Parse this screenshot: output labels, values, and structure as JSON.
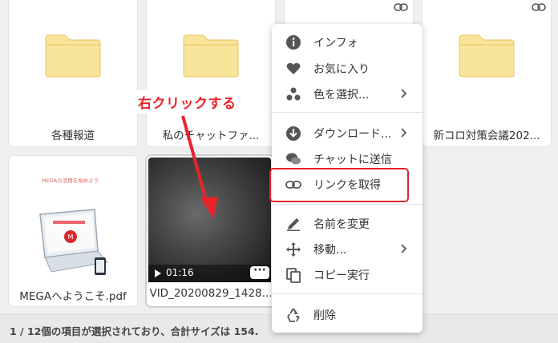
{
  "cards": {
    "c1": {
      "name": "各種報道"
    },
    "c2": {
      "name": "私のチャットファ..."
    },
    "c4": {
      "name": "新コロ対策会議202..."
    },
    "pdf": {
      "name": "MEGAへようこそ.pdf",
      "thumb_header": "MEGAの活用を始めよう"
    },
    "video": {
      "name": "VID_20200829_1428...",
      "duration": "01:16",
      "more": "···"
    }
  },
  "context_menu": {
    "items": [
      {
        "label": "インフォ",
        "icon": "info-icon"
      },
      {
        "label": "お気に入り",
        "icon": "heart-icon"
      },
      {
        "label": "色を選択...",
        "icon": "color-dots-icon",
        "submenu": true
      },
      {
        "label": "ダウンロード...",
        "icon": "download-icon",
        "submenu": true
      },
      {
        "label": "チャットに送信",
        "icon": "chat-icon"
      },
      {
        "label": "リンクを取得",
        "icon": "link-icon"
      },
      {
        "label": "名前を変更",
        "icon": "pen-icon"
      },
      {
        "label": "移動...",
        "icon": "move-icon",
        "submenu": true
      },
      {
        "label": "コピー実行",
        "icon": "copy-icon"
      },
      {
        "label": "削除",
        "icon": "recycle-icon"
      }
    ]
  },
  "annotation": {
    "text": "右クリックする"
  },
  "status_bar": {
    "text": "1 / 12個の項目が選択されており、合計サイズは 154."
  },
  "colors": {
    "accent_red": "#e8232a",
    "folder": "#f9e49b",
    "folder_stroke": "#e8c65a"
  }
}
